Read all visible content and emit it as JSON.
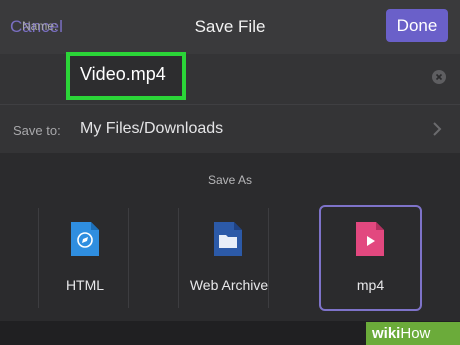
{
  "header": {
    "cancel_label": "Cancel",
    "title": "Save File",
    "done_label": "Done"
  },
  "name_field": {
    "label": "Name:",
    "value": "Video.mp4"
  },
  "save_to": {
    "label": "Save to:",
    "value": "My Files/Downloads"
  },
  "save_as": {
    "heading": "Save As",
    "options": [
      {
        "label": "HTML",
        "icon": "compass-document-icon",
        "selected": false
      },
      {
        "label": "Web Archive",
        "icon": "folder-document-icon",
        "selected": false
      },
      {
        "label": "mp4",
        "icon": "play-document-icon",
        "selected": true
      }
    ]
  },
  "watermark": {
    "wiki": "wiki",
    "how": "How"
  },
  "colors": {
    "accent": "#6a60c9",
    "highlight": "#2bd538",
    "background": "#2b2b2d"
  }
}
